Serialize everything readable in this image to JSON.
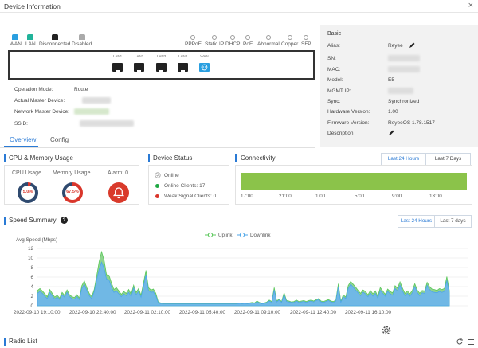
{
  "window": {
    "title": "Device Information",
    "close_icon": "×"
  },
  "legend": [
    {
      "label": "WAN",
      "color": "#2a9fe0"
    },
    {
      "label": "LAN",
      "color": "#21b39a"
    },
    {
      "label": "Disconnected",
      "color": "#222222"
    },
    {
      "label": "Disabled",
      "color": "#aaaaaa"
    }
  ],
  "wan_modes": [
    {
      "label": "PPPoE",
      "icon": "pppoe-icon"
    },
    {
      "label": "Static IP",
      "icon": "static-ip-icon"
    },
    {
      "label": "DHCP",
      "icon": "dhcp-icon"
    },
    {
      "label": "PoE",
      "icon": "poe-icon"
    },
    {
      "label": "Abnormal",
      "icon": "abnormal-icon"
    },
    {
      "label": "Copper",
      "icon": "copper-icon"
    },
    {
      "label": "SFP",
      "icon": "sfp-icon"
    }
  ],
  "ports": [
    {
      "label": "LAN1",
      "type": "lan"
    },
    {
      "label": "LAN2",
      "type": "lan"
    },
    {
      "label": "LAN3",
      "type": "lan"
    },
    {
      "label": "LAN4",
      "type": "lan"
    },
    {
      "label": "WAN",
      "type": "wan"
    }
  ],
  "info": {
    "operation_mode_label": "Operation Mode:",
    "operation_mode_value": "Route",
    "actual_master_label": "Actual Master Device:",
    "network_master_label": "Network Master Device:",
    "ssid_label": "SSID:"
  },
  "basic": {
    "title": "Basic",
    "rows": [
      {
        "label": "Alias:",
        "value": "Reyee"
      },
      {
        "label": "SN:",
        "value": ""
      },
      {
        "label": "MAC:",
        "value": ""
      },
      {
        "label": "Model:",
        "value": "E5"
      },
      {
        "label": "MGMT IP:",
        "value": ""
      },
      {
        "label": "Sync:",
        "value": "Synchronized"
      },
      {
        "label": "Hardware Version:",
        "value": "1.00"
      },
      {
        "label": "Firmware Version:",
        "value": "ReyeeOS 1.78.1517"
      },
      {
        "label": "Description",
        "value": ""
      }
    ]
  },
  "tabs": [
    {
      "label": "Overview"
    },
    {
      "label": "Config"
    }
  ],
  "cpu_memory": {
    "title": "CPU & Memory Usage",
    "cpu_label": "CPU Usage",
    "cpu_value": "5.0%",
    "cpu_pct": 5,
    "mem_label": "Memory Usage",
    "mem_value": "67.5%",
    "mem_pct": 67.5,
    "alarm_label": "Alarm: 0"
  },
  "device_status": {
    "title": "Device Status",
    "online": "Online",
    "online_clients": "Online Clients: 17",
    "weak_clients": "Weak Signal Clients: 0",
    "colors": {
      "online": "#1fa843",
      "weak": "#d9362b"
    }
  },
  "connectivity": {
    "title": "Connectivity",
    "btn_24h": "Last 24 Hours",
    "btn_7d": "Last 7 Days",
    "ticks": [
      "17:00",
      "21:00",
      "1:00",
      "5:00",
      "9:00",
      "13:00"
    ],
    "bar_color": "#8bc34a"
  },
  "speed": {
    "title": "Speed Summary",
    "btn_24h": "Last 24 Hours",
    "btn_7d": "Last 7 days",
    "ylabel": "Avg Speed (Mbps)",
    "legend_uplink": "Uplink",
    "legend_downlink": "Downlink"
  },
  "chart_data": {
    "type": "area",
    "ylim": [
      0,
      12
    ],
    "yticks": [
      0,
      2,
      4,
      6,
      8,
      10,
      12
    ],
    "xtick_labels": [
      "2022-09-10 19:10:00",
      "2022-09-10 22:40:00",
      "2022-09-11 02:10:00",
      "2022-09-11 05:40:00",
      "2022-09-11 09:10:00",
      "2022-09-11 12:40:00",
      "2022-09-11 16:10:00"
    ],
    "series": [
      {
        "name": "Uplink",
        "color": "#5cc85c",
        "values": [
          3.2,
          3.6,
          3.1,
          2.5,
          1.9,
          3.4,
          2.6,
          1.8,
          2.2,
          1.6,
          2.8,
          2.2,
          3.3,
          2.3,
          1.9,
          1.7,
          2.3,
          1.6,
          4.2,
          5.2,
          3.8,
          2.6,
          1.9,
          3.4,
          6.2,
          9.2,
          11.3,
          9.6,
          6.5,
          6.4,
          4.8,
          3.4,
          3.8,
          3.1,
          2.4,
          3.0,
          2.6,
          3.4,
          2.4,
          4.3,
          2.8,
          3.6,
          2.2,
          4.8,
          7.4,
          3.8,
          3.3,
          3.5,
          2.6,
          0.8,
          0.6,
          0.5,
          0.5,
          0.5,
          0.5,
          0.5,
          0.5,
          0.5,
          0.5,
          0.5,
          0.5,
          0.5,
          0.5,
          0.5,
          0.5,
          0.5,
          0.5,
          0.5,
          0.5,
          0.5,
          0.5,
          0.5,
          0.5,
          0.5,
          0.5,
          0.5,
          0.5,
          0.5,
          0.5,
          0.5,
          0.5,
          0.5,
          0.6,
          0.5,
          0.6,
          0.5,
          0.6,
          0.7,
          0.6,
          1.0,
          0.7,
          0.5,
          0.6,
          0.8,
          1.2,
          0.9,
          3.8,
          1.0,
          1.4,
          0.9,
          2.7,
          1.1,
          1.0,
          0.8,
          0.9,
          1.2,
          0.9,
          1.0,
          1.1,
          0.9,
          1.1,
          1.2,
          1.0,
          1.3,
          1.5,
          1.0,
          0.9,
          1.1,
          1.3,
          1.0,
          0.9,
          1.2,
          4.6,
          0.9,
          2.3,
          1.8,
          4.2,
          5.1,
          4.5,
          3.9,
          3.2,
          2.6,
          3.3,
          3.0,
          2.3,
          3.2,
          2.5,
          3.1,
          2.0,
          3.8,
          3.1,
          2.4,
          3.5,
          3.0,
          2.7,
          4.2,
          3.7,
          5.0,
          3.7,
          2.6,
          3.1,
          2.5,
          3.2,
          4.6,
          3.3,
          2.6,
          3.2,
          3.1,
          4.9,
          4.0,
          3.5,
          3.4,
          3.2,
          3.6,
          3.4,
          3.6,
          6.1,
          3.2
        ]
      },
      {
        "name": "Downlink",
        "color": "#4da6e8",
        "values": [
          2.6,
          3.0,
          2.6,
          2.0,
          1.5,
          2.8,
          2.1,
          1.4,
          1.8,
          1.3,
          2.3,
          1.8,
          2.8,
          1.9,
          1.5,
          1.4,
          1.9,
          1.3,
          3.6,
          4.5,
          3.2,
          2.1,
          1.5,
          2.9,
          5.4,
          7.6,
          9.1,
          7.9,
          5.6,
          5.4,
          3.9,
          2.8,
          3.1,
          2.5,
          1.9,
          2.5,
          2.1,
          2.8,
          1.9,
          3.7,
          2.3,
          3.0,
          1.8,
          4.1,
          6.5,
          3.2,
          2.8,
          2.9,
          2.1,
          0.6,
          0.4,
          0.4,
          0.4,
          0.4,
          0.4,
          0.4,
          0.4,
          0.4,
          0.4,
          0.4,
          0.4,
          0.4,
          0.4,
          0.4,
          0.4,
          0.4,
          0.4,
          0.4,
          0.4,
          0.4,
          0.4,
          0.4,
          0.4,
          0.4,
          0.4,
          0.4,
          0.4,
          0.4,
          0.4,
          0.4,
          0.4,
          0.4,
          0.5,
          0.4,
          0.5,
          0.4,
          0.5,
          0.6,
          0.5,
          0.8,
          0.6,
          0.4,
          0.5,
          0.7,
          1.0,
          0.7,
          3.3,
          0.8,
          1.2,
          0.7,
          2.3,
          0.9,
          0.8,
          0.7,
          0.7,
          1.0,
          0.7,
          0.8,
          0.9,
          0.7,
          0.9,
          1.0,
          0.8,
          1.1,
          1.3,
          0.8,
          0.7,
          0.9,
          1.1,
          0.8,
          0.7,
          1.0,
          4.0,
          0.7,
          1.9,
          1.5,
          3.6,
          4.5,
          3.9,
          3.3,
          2.7,
          2.1,
          2.8,
          2.5,
          1.9,
          2.7,
          2.0,
          2.6,
          1.6,
          3.2,
          2.6,
          2.0,
          3.0,
          2.5,
          2.2,
          3.6,
          3.1,
          4.3,
          3.1,
          2.1,
          2.6,
          2.0,
          2.7,
          4.0,
          2.8,
          2.1,
          2.7,
          2.6,
          4.3,
          3.4,
          2.9,
          2.8,
          2.7,
          3.0,
          2.8,
          3.0,
          5.3,
          2.7
        ]
      }
    ]
  },
  "radio": {
    "title": "Radio List"
  }
}
